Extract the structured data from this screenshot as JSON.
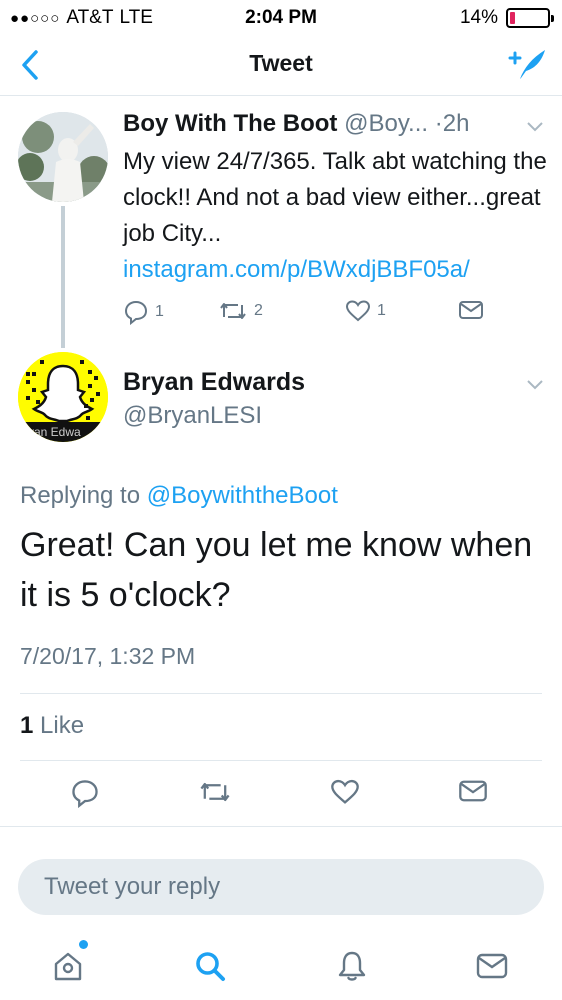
{
  "status_bar": {
    "signal": "●●○○○",
    "carrier": "AT&T",
    "network": "LTE",
    "time": "2:04 PM",
    "battery_percent": "14%",
    "battery_level": 0.14
  },
  "nav": {
    "title": "Tweet",
    "back_icon": "chevron-left-icon",
    "compose_icon": "compose-tweet-icon"
  },
  "parent_tweet": {
    "name": "Boy With The Boot",
    "handle": "@Boy...",
    "separator": "·",
    "time": "2h",
    "text": "My view 24/7/365. Talk abt watching the clock!! And not a bad view either...great job City...",
    "link": "instagram.com/p/BWxdjBBF05a/",
    "reply_count": "1",
    "retweet_count": "2",
    "like_count": "1"
  },
  "tweet": {
    "name": "Bryan Edwards",
    "handle": "@BryanLESI",
    "avatar_label": "yan Edwa",
    "replying_prefix": "Replying to",
    "replying_handle": "@BoywiththeBoot",
    "text": "Great! Can you let me know when it is 5 o'clock?",
    "timestamp": "7/20/17, 1:32 PM",
    "likes_count": "1",
    "likes_label": "Like"
  },
  "reply": {
    "placeholder": "Tweet your reply"
  },
  "tab_bar": {
    "items": [
      "home-icon",
      "search-icon",
      "notifications-icon",
      "messages-icon"
    ]
  },
  "colors": {
    "accent": "#1da1f2",
    "text": "#14171a",
    "secondary_text": "#657786",
    "battery_low": "#e0245e",
    "snapcode_yellow": "#fffc00"
  }
}
